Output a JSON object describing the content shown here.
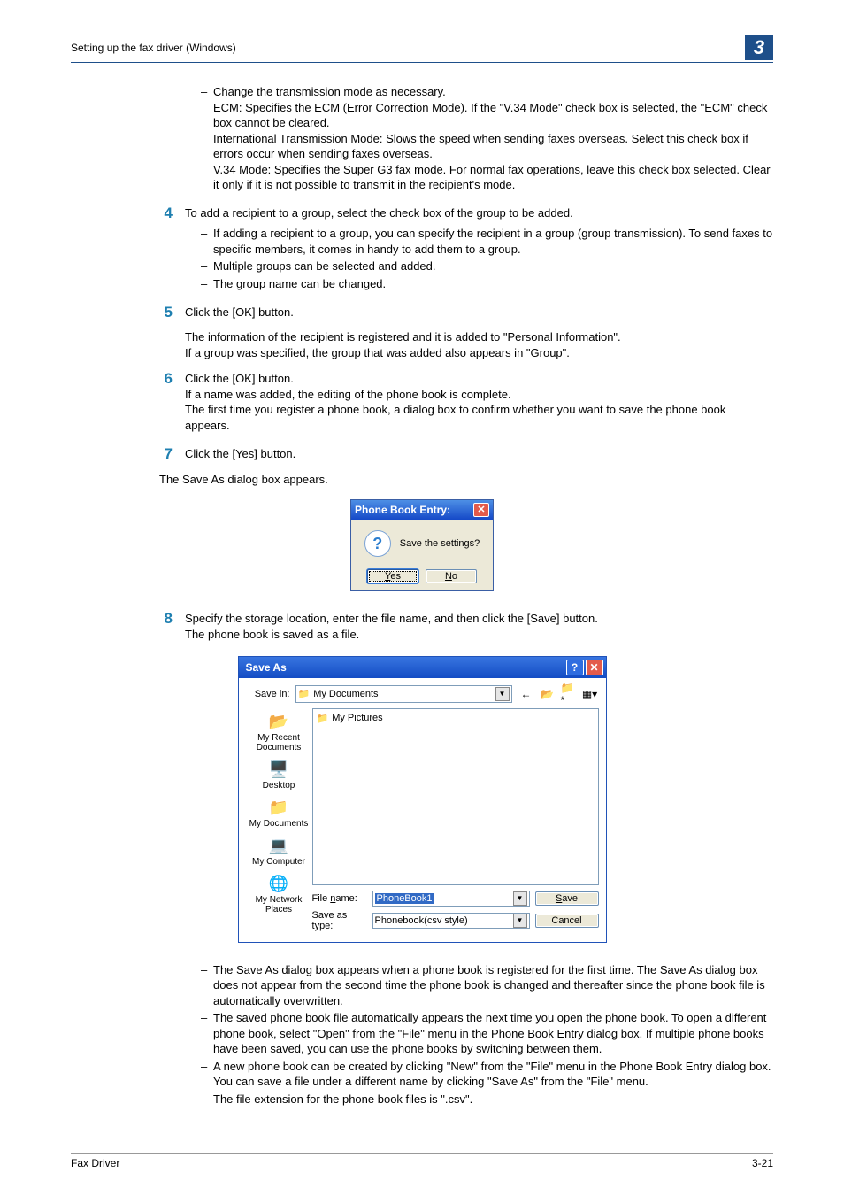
{
  "header": {
    "title": "Setting up the fax driver (Windows)",
    "chapter": "3"
  },
  "step_dash": {
    "items": [
      "Change the transmission mode as necessary.",
      "ECM: Specifies the ECM (Error Correction Mode). If the \"V.34 Mode\" check box is selected, the \"ECM\" check box cannot be cleared.",
      "International Transmission Mode: Slows the speed when sending faxes overseas. Select this check box if errors occur when sending faxes overseas.",
      "V.34 Mode: Specifies the Super G3 fax mode. For normal fax operations, leave this check box selected. Clear it only if it is not possible to transmit in the recipient's mode."
    ]
  },
  "step4": {
    "num": "4",
    "text": "To add a recipient to a group, select the check box of the group to be added.",
    "items": [
      "If adding a recipient to a group, you can specify the recipient in a group (group transmission). To send faxes to specific members, it comes in handy to add them to a group.",
      "Multiple groups can be selected and added.",
      "The group name can be changed."
    ]
  },
  "step5": {
    "num": "5",
    "text": "Click the [OK] button.",
    "after1": "The information of the recipient is registered and it is added to \"Personal Information\".",
    "after2": "If a group was specified, the group that was added also appears in \"Group\"."
  },
  "step6": {
    "num": "6",
    "line1": "Click the [OK] button.",
    "line2": "If a name was added, the editing of the phone book is complete.",
    "line3": "The first time you register a phone book, a dialog box to confirm whether you want to save the phone book appears."
  },
  "step7": {
    "num": "7",
    "text": "Click the [Yes] button.",
    "after": "The Save As dialog box appears."
  },
  "pbe": {
    "title": "Phone Book Entry:",
    "msg": "Save the settings?",
    "yes_u": "Y",
    "yes_rest": "es",
    "no_u": "N",
    "no_rest": "o"
  },
  "step8": {
    "num": "8",
    "line1": "Specify the storage location, enter the file name, and then click the [Save] button.",
    "line2": "The phone book is saved as a file."
  },
  "saveas": {
    "title": "Save As",
    "savein_label_u": "i",
    "savein_label_pre": "Save ",
    "savein_label_post": "n:",
    "savein_value": "My Documents",
    "folder": "My Pictures",
    "side": {
      "recent": "My Recent Documents",
      "desktop": "Desktop",
      "mydocs": "My Documents",
      "mycomp": "My Computer",
      "mynet": "My Network Places"
    },
    "filename_label_pre": "File ",
    "filename_label_u": "n",
    "filename_label_post": "ame:",
    "filename_value": "PhoneBook1",
    "savetype_label_pre": "Save as ",
    "savetype_label_u": "t",
    "savetype_label_post": "ype:",
    "savetype_value": "Phonebook(csv style)",
    "save_btn_u": "S",
    "save_btn_rest": "ave",
    "cancel_btn": "Cancel"
  },
  "final_notes": [
    "The Save As dialog box appears when a phone book is registered for the first time. The Save As dialog box does not appear from the second time the phone book is changed and thereafter since the phone book file is automatically overwritten.",
    "The saved phone book file automatically appears the next time you open the phone book. To open a different phone book, select \"Open\" from the \"File\" menu in the Phone Book Entry dialog box. If multiple phone books have been saved, you can use the phone books by switching between them.",
    "A new phone book can be created by clicking \"New\" from the \"File\" menu in the Phone Book Entry dialog box. You can save a file under a different name by clicking \"Save As\" from the \"File\" menu.",
    "The file extension for the phone book files is \".csv\"."
  ],
  "footer": {
    "left": "Fax Driver",
    "right": "3-21"
  }
}
